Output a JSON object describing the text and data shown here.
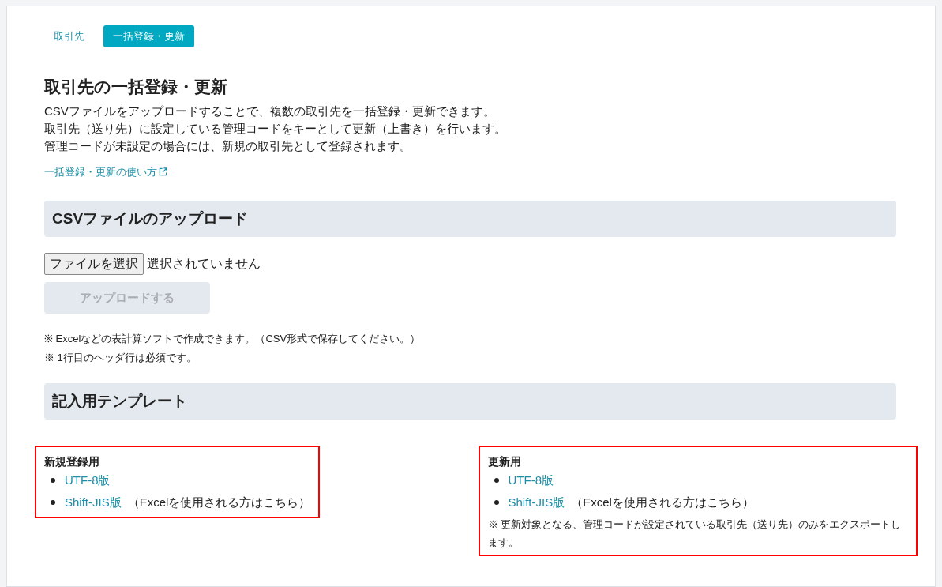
{
  "tabs": [
    {
      "label": "取引先",
      "selected": false
    },
    {
      "label": "一括登録・更新",
      "selected": true
    }
  ],
  "title": "取引先の一括登録・更新",
  "description": [
    "CSVファイルをアップロードすることで、複数の取引先を一括登録・更新できます。",
    "取引先（送り先）に設定している管理コードをキーとして更新（上書き）を行います。",
    "管理コードが未設定の場合には、新規の取引先として登録されます。"
  ],
  "help_link": "一括登録・更新の使い方",
  "upload_section": {
    "heading": "CSVファイルのアップロード",
    "file_button": "ファイルを選択",
    "file_status": "選択されていません",
    "upload_button": {
      "label": "アップロードする",
      "disabled": true
    },
    "notes": [
      "※ Excelなどの表計算ソフトで作成できます。（CSV形式で保存してください。）",
      "※ 1行目のヘッダ行は必須です。"
    ]
  },
  "template_section": {
    "heading": "記入用テンプレート",
    "groups": [
      {
        "title": "新規登録用",
        "links": [
          {
            "label": "UTF-8版"
          },
          {
            "label": "Shift-JIS版",
            "suffix": "（Excelを使用される方はこちら）"
          }
        ]
      },
      {
        "title": "更新用",
        "links": [
          {
            "label": "UTF-8版"
          },
          {
            "label": "Shift-JIS版",
            "suffix": "（Excelを使用される方はこちら）"
          }
        ],
        "note": "※ 更新対象となる、管理コードが設定されている取引先（送り先）のみをエクスポートします。"
      }
    ]
  }
}
